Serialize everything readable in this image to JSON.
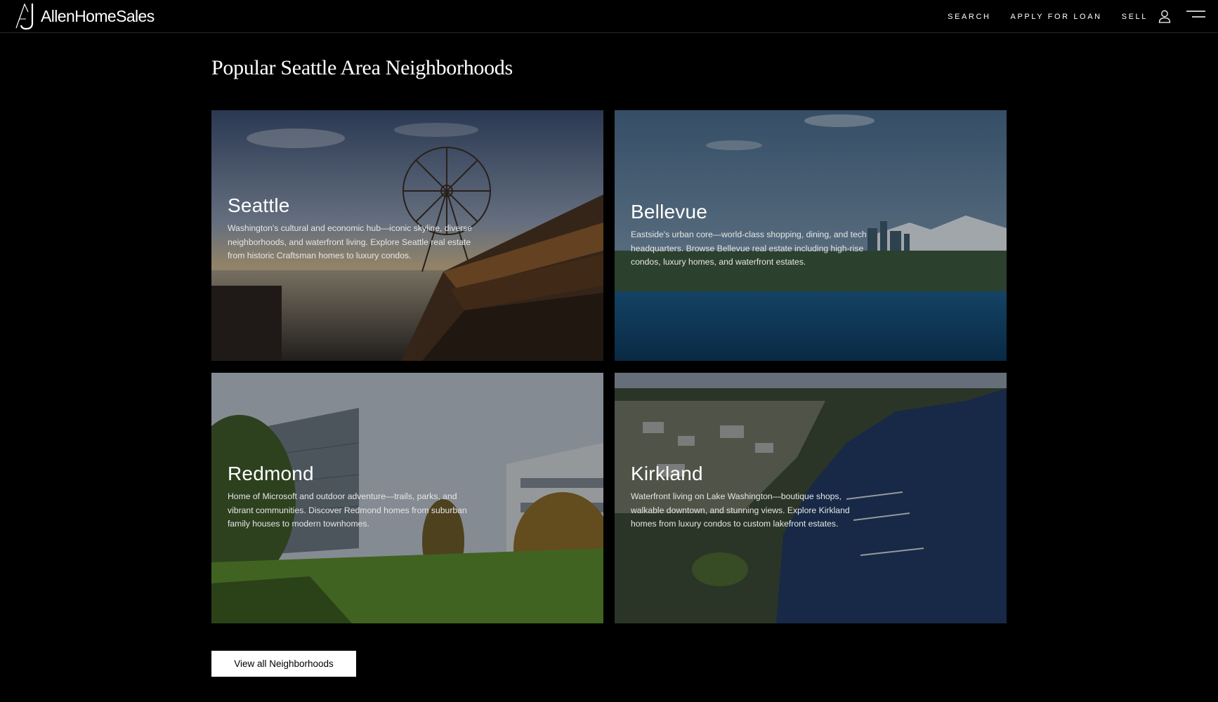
{
  "header": {
    "logo_text": "AllenHomeSales",
    "logo_icon": "aj-monogram-logo",
    "nav": [
      {
        "label": "SEARCH"
      },
      {
        "label": "APPLY FOR LOAN"
      },
      {
        "label": "SELL"
      }
    ],
    "user_icon": "user-icon",
    "menu_icon": "hamburger-menu-icon"
  },
  "section": {
    "title": "Popular Seattle Area Neighborhoods"
  },
  "neighborhoods": [
    {
      "name": "Seattle",
      "description": "Washington's cultural and economic hub—iconic skyline, diverse neighborhoods, and waterfront living. Explore Seattle real estate from historic Craftsman homes to luxury condos.",
      "image": "seattle-waterfront-ferris-wheel-photo"
    },
    {
      "name": "Bellevue",
      "description": "Eastside's urban core—world-class shopping, dining, and tech headquarters. Browse Bellevue real estate including high-rise condos, luxury homes, and waterfront estates.",
      "image": "bellevue-skyline-lake-photo"
    },
    {
      "name": "Redmond",
      "description": "Home of Microsoft and outdoor adventure—trails, parks, and vibrant communities. Discover Redmond homes from suburban family houses to modern townhomes.",
      "image": "redmond-campus-lawn-photo"
    },
    {
      "name": "Kirkland",
      "description": "Waterfront living on Lake Washington—boutique shops, walkable downtown, and stunning views. Explore Kirkland homes from luxury condos to custom lakefront estates.",
      "image": "kirkland-aerial-marina-photo"
    }
  ],
  "cta": {
    "label": "View all Neighborhoods"
  },
  "colors": {
    "background": "#000000",
    "text": "#ffffff",
    "button_bg": "#ffffff",
    "button_text": "#000000"
  }
}
